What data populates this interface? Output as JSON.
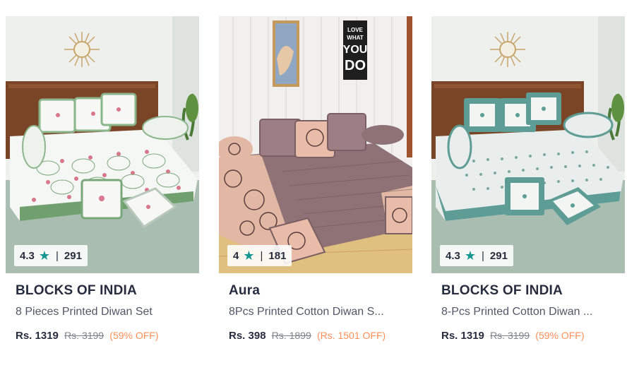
{
  "products": [
    {
      "rating": "4.3",
      "rating_count": "291",
      "brand": "BLOCKS OF INDIA",
      "name": "8 Pieces Printed Diwan Set",
      "price": "Rs. 1319",
      "mrp": "Rs. 3199",
      "discount": "(59% OFF)",
      "image": "white-green-floral-diwan-set"
    },
    {
      "rating": "4",
      "rating_count": "181",
      "brand": "Aura",
      "name": "8Pcs Printed Cotton Diwan S...",
      "price": "Rs. 398",
      "mrp": "Rs. 1899",
      "discount": "(Rs. 1501 OFF)",
      "image": "peach-brown-floral-diwan-set",
      "poster_text": "LOVE WHAT YOU DO"
    },
    {
      "rating": "4.3",
      "rating_count": "291",
      "brand": "BLOCKS OF INDIA",
      "name": "8-Pcs Printed Cotton Diwan ...",
      "price": "Rs. 1319",
      "mrp": "Rs. 3199",
      "discount": "(59% OFF)",
      "image": "teal-block-print-diwan-set"
    }
  ],
  "colors": {
    "rating_star": "#14958f",
    "discount": "#ff905a",
    "brand_text": "#282c3f",
    "name_text": "#535766",
    "mrp_text": "#7e818c"
  },
  "icons": {
    "rating_star": "star-icon"
  }
}
